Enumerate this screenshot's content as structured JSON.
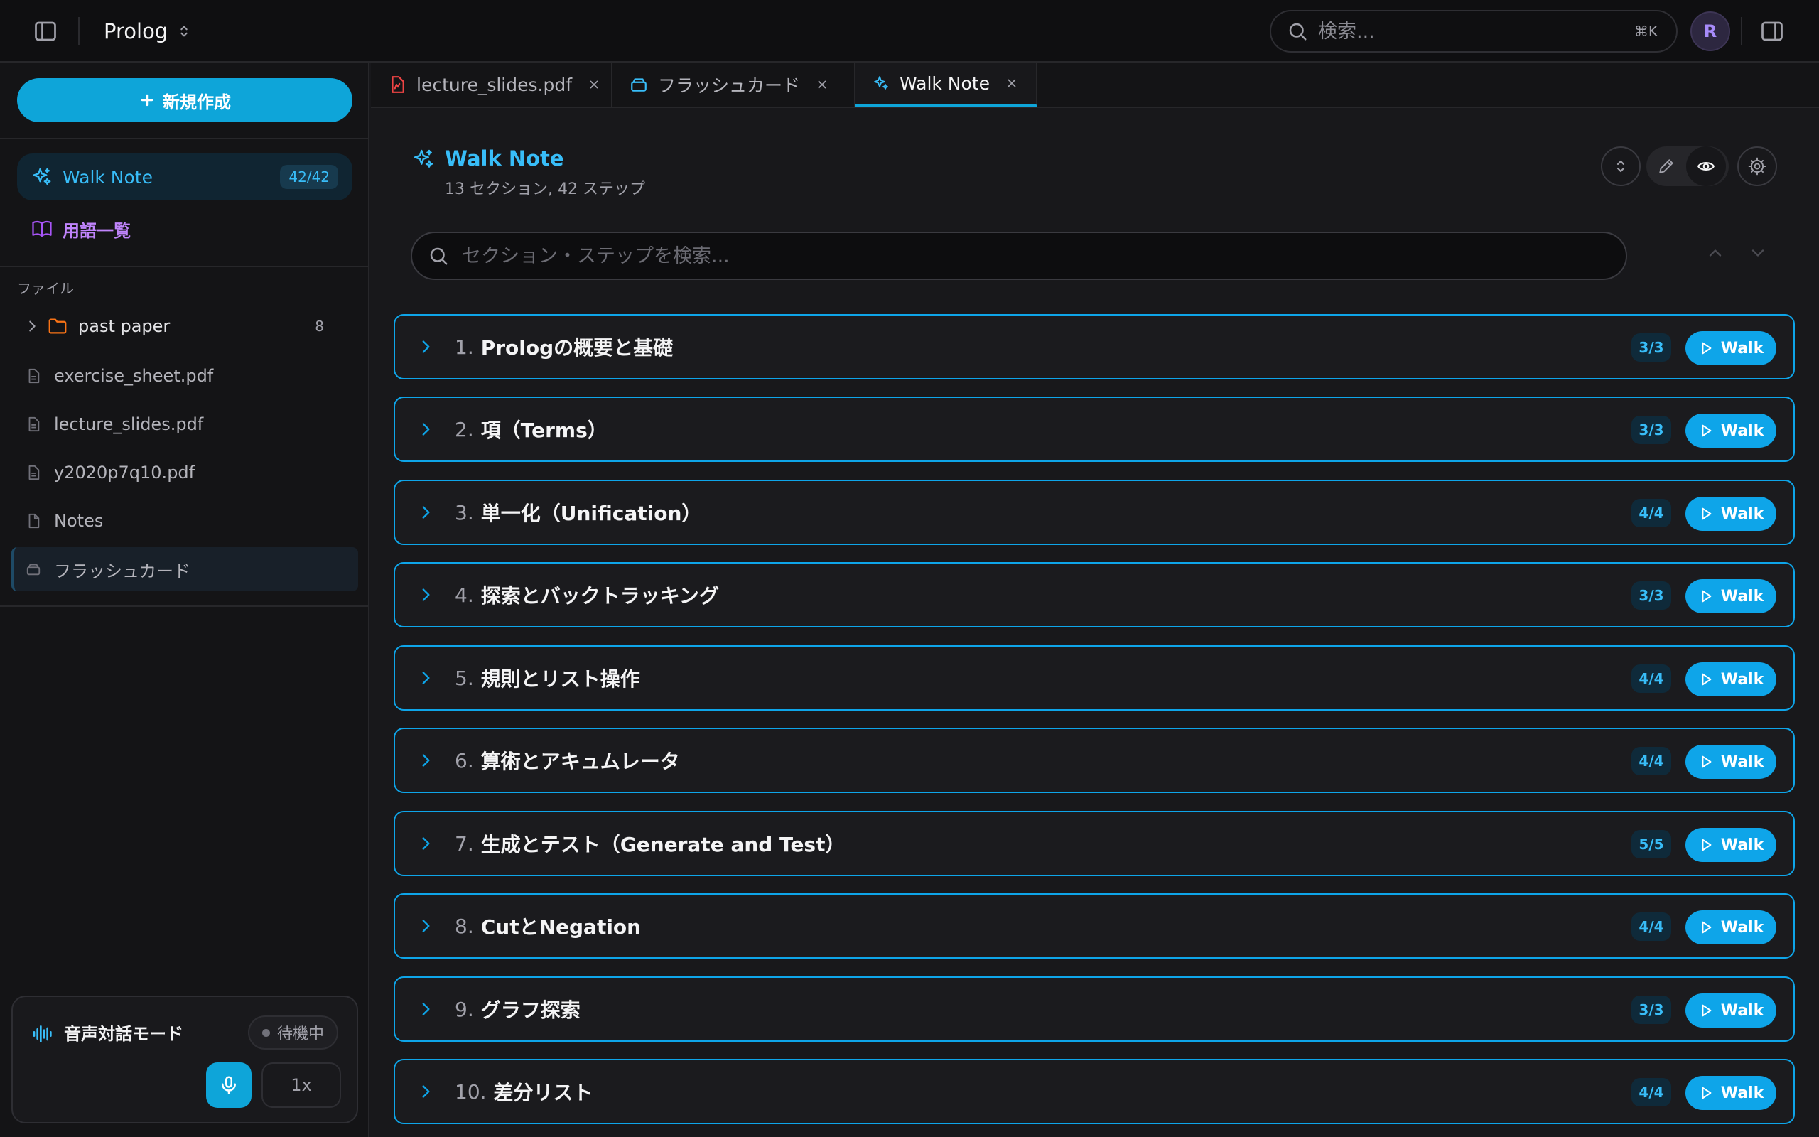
{
  "header": {
    "project_name": "Prolog",
    "search_placeholder": "検索...",
    "search_shortcut": "⌘K",
    "avatar_initial": "R"
  },
  "sidebar": {
    "new_button_label": "新規作成",
    "nav": [
      {
        "label": "Walk Note",
        "count": "42/42"
      },
      {
        "label": "用語一覧"
      }
    ],
    "files_heading": "ファイル",
    "folder": {
      "name": "past paper",
      "count": "8"
    },
    "files": [
      {
        "name": "exercise_sheet.pdf"
      },
      {
        "name": "lecture_slides.pdf"
      },
      {
        "name": "y2020p7q10.pdf"
      },
      {
        "name": "Notes"
      },
      {
        "name": "フラッシュカード"
      }
    ],
    "voice": {
      "title": "音声対話モード",
      "status": "待機中",
      "speed": "1x"
    }
  },
  "tabs": [
    {
      "label": "lecture_slides.pdf"
    },
    {
      "label": "フラッシュカード"
    },
    {
      "label": "Walk Note"
    }
  ],
  "walk_note": {
    "title": "Walk Note",
    "subtitle": "13 セクション, 42 ステップ",
    "search_placeholder": "セクション・ステップを検索...",
    "walk_label": "Walk",
    "sections": [
      {
        "number": "1.",
        "title": "Prologの概要と基礎",
        "count": "3/3"
      },
      {
        "number": "2.",
        "title": "項（Terms）",
        "count": "3/3"
      },
      {
        "number": "3.",
        "title": "単一化（Unification）",
        "count": "4/4"
      },
      {
        "number": "4.",
        "title": "探索とバックトラッキング",
        "count": "3/3"
      },
      {
        "number": "5.",
        "title": "規則とリスト操作",
        "count": "4/4"
      },
      {
        "number": "6.",
        "title": "算術とアキュムレータ",
        "count": "4/4"
      },
      {
        "number": "7.",
        "title": "生成とテスト（Generate and Test）",
        "count": "5/5"
      },
      {
        "number": "8.",
        "title": "CutとNegation",
        "count": "4/4"
      },
      {
        "number": "9.",
        "title": "グラフ探索",
        "count": "3/3"
      },
      {
        "number": "10.",
        "title": "差分リスト",
        "count": "4/4"
      }
    ]
  },
  "colors": {
    "accent": "#0ea5e9",
    "accent_text": "#38bdf8",
    "glossary": "#c084fc",
    "folder": "#f97316",
    "pdf_icon": "#ef4444",
    "background": "#18181b"
  },
  "icons": [
    "sidebar-toggle-icon",
    "chevron-updown-icon",
    "search-icon",
    "right-panel-icon",
    "plus-icon",
    "sparkles-icon",
    "book-icon",
    "chevron-right-icon",
    "folder-icon",
    "file-text-icon",
    "file-icon",
    "flashcard-icon",
    "audio-wave-icon",
    "mic-icon",
    "pdf-icon",
    "close-icon",
    "collapse-icon",
    "pencil-icon",
    "eye-icon",
    "gear-icon",
    "chevron-up-icon",
    "chevron-down-icon",
    "play-icon"
  ]
}
